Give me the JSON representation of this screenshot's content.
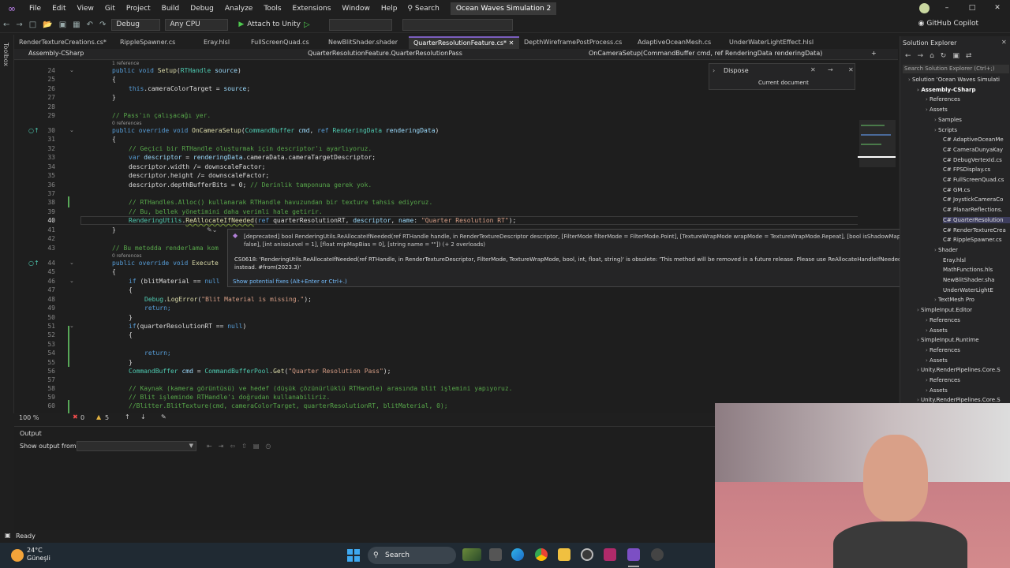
{
  "menu": {
    "items": [
      "File",
      "Edit",
      "View",
      "Git",
      "Project",
      "Build",
      "Debug",
      "Analyze",
      "Tools",
      "Extensions",
      "Window",
      "Help"
    ],
    "search_label": "Search",
    "solution_title": "Ocean Waves Simulation 2"
  },
  "toolbar": {
    "config": "Debug",
    "platform": "Any CPU",
    "attach_label": "Attach to Unity",
    "copilot_label": "GitHub Copilot"
  },
  "left_strip": {
    "label": "Toolbox"
  },
  "tabs": [
    {
      "label": "RenderTextureCreations.cs*",
      "active": false
    },
    {
      "label": "RippleSpawner.cs",
      "active": false
    },
    {
      "label": "Eray.hlsl",
      "active": false
    },
    {
      "label": "FullScreenQuad.cs",
      "active": false
    },
    {
      "label": "NewBlitShader.shader",
      "active": false
    },
    {
      "label": "QuarterResolutionFeature.cs*",
      "active": true
    },
    {
      "label": "DepthWireframePostProcess.cs",
      "active": false
    },
    {
      "label": "AdaptiveOceanMesh.cs",
      "active": false
    },
    {
      "label": "UnderWaterLightEffect.hlsl",
      "active": false
    }
  ],
  "navbar": {
    "project": "Assembly-CSharp",
    "class": "QuarterResolutionFeature.QuarterResolutionPass",
    "member": "OnCameraSetup(CommandBuffer cmd, ref RenderingData renderingData)"
  },
  "code": {
    "refs_1": "1 reference",
    "refs_0": "0 references",
    "lines": [
      {
        "n": "24",
        "text": "public void Setup(RTHandle source)"
      },
      {
        "n": "25",
        "text": "{"
      },
      {
        "n": "26",
        "text": "this.cameraColorTarget = source;"
      },
      {
        "n": "27",
        "text": "}"
      },
      {
        "n": "28",
        "text": ""
      },
      {
        "n": "29",
        "text": "// Pass'ın çalışacağı yer."
      },
      {
        "n": "30",
        "text": "public override void OnCameraSetup(CommandBuffer cmd, ref RenderingData renderingData)"
      },
      {
        "n": "31",
        "text": "{"
      },
      {
        "n": "32",
        "text": "// Geçici bir RTHandle oluşturmak için descriptor'ı ayarlıyoruz."
      },
      {
        "n": "33",
        "text": "var descriptor = renderingData.cameraData.cameraTargetDescriptor;"
      },
      {
        "n": "34",
        "text": "descriptor.width /= downscaleFactor;"
      },
      {
        "n": "35",
        "text": "descriptor.height /= downscaleFactor;"
      },
      {
        "n": "36",
        "text": "descriptor.depthBufferBits = 0; // Derinlik tamponuna gerek yok."
      },
      {
        "n": "37",
        "text": ""
      },
      {
        "n": "38",
        "text": "// RTHandles.Alloc() kullanarak RTHandle havuzundan bir texture tahsis ediyoruz."
      },
      {
        "n": "39",
        "text": "// Bu, bellek yönetimini daha verimli hale getirir."
      },
      {
        "n": "40",
        "text": "RenderingUtils.ReAllocateIfNeeded(ref quarterResolutionRT, descriptor, name: \"Quarter Resolution RT\");"
      },
      {
        "n": "41",
        "text": "}"
      },
      {
        "n": "42",
        "text": ""
      },
      {
        "n": "43",
        "text": "// Bu metodda renderlama kom"
      },
      {
        "n": "44",
        "text": "public override void Execute"
      },
      {
        "n": "45",
        "text": "{"
      },
      {
        "n": "46",
        "text": "if (blitMaterial == null"
      },
      {
        "n": "47",
        "text": "{"
      },
      {
        "n": "48",
        "text": "Debug.LogError(\"Blit Material is missing.\");"
      },
      {
        "n": "49",
        "text": "return;"
      },
      {
        "n": "50",
        "text": "}"
      },
      {
        "n": "51",
        "text": "if(quarterResolutionRT == null)"
      },
      {
        "n": "52",
        "text": "{"
      },
      {
        "n": "53",
        "text": ""
      },
      {
        "n": "54",
        "text": "return;"
      },
      {
        "n": "55",
        "text": "}"
      },
      {
        "n": "56",
        "text": "CommandBuffer cmd = CommandBufferPool.Get(\"Quarter Resolution Pass\");"
      },
      {
        "n": "57",
        "text": ""
      },
      {
        "n": "58",
        "text": "// Kaynak (kamera görüntüsü) ve hedef (düşük çözünürlüklü RTHandle) arasında blit işlemini yapıyoruz."
      },
      {
        "n": "59",
        "text": "// Blit işleminde RTHandle'ı doğrudan kullanabiliriz."
      },
      {
        "n": "60",
        "text": "//Blitter.BlitTexture(cmd, cameraColorTarget, quarterResolutionRT, blitMaterial, 0);"
      }
    ]
  },
  "dispose_panel": {
    "title": "Dispose",
    "scope": "Current document"
  },
  "tooltip": {
    "signature": "[deprecated] bool RenderingUtils.ReAllocateIfNeeded(ref RTHandle handle, in RenderTextureDescriptor descriptor, [FilterMode filterMode = FilterMode.Point], [TextureWrapMode wrapMode = TextureWrapMode.Repeat], [bool isShadowMap = false], [int anisoLevel = 1], [float mipMapBias = 0], [string name = \"\"]) (+ 2 overloads)",
    "warning": "CS0618: 'RenderingUtils.ReAllocateIfNeeded(ref RTHandle, in RenderTextureDescriptor, FilterMode, TextureWrapMode, bool, int, float, string)' is obsolete: 'This method will be removed in a future release. Please use ReAllocateHandleIfNeeded",
    "warning2": "instead. #from(2023.3)'",
    "fix": "Show potential fixes (Alt+Enter or Ctrl+.)"
  },
  "editor_status": {
    "zoom": "100 %",
    "errors": "0",
    "warnings": "5"
  },
  "solution_explorer": {
    "title": "Solution Explorer",
    "search_placeholder": "Search Solution Explorer (Ctrl+;)",
    "nodes": [
      {
        "label": "Solution 'Ocean Waves Simulati",
        "depth": 0,
        "bold": false
      },
      {
        "label": "Assembly-CSharp",
        "depth": 1,
        "bold": true
      },
      {
        "label": "References",
        "depth": 2,
        "bold": false
      },
      {
        "label": "Assets",
        "depth": 2,
        "bold": false
      },
      {
        "label": "Samples",
        "depth": 3,
        "bold": false
      },
      {
        "label": "Scripts",
        "depth": 3,
        "bold": false
      },
      {
        "label": "C# AdaptiveOceanMe",
        "depth": 4,
        "bold": false
      },
      {
        "label": "C# CameraDunyaKay",
        "depth": 4,
        "bold": false
      },
      {
        "label": "C# DebugVertexId.cs",
        "depth": 4,
        "bold": false
      },
      {
        "label": "C# FPSDisplay.cs",
        "depth": 4,
        "bold": false
      },
      {
        "label": "C# FullScreenQuad.cs",
        "depth": 4,
        "bold": false
      },
      {
        "label": "C# GM.cs",
        "depth": 4,
        "bold": false
      },
      {
        "label": "C# JoystickCameraCo",
        "depth": 4,
        "bold": false
      },
      {
        "label": "C# PlanarReflections.",
        "depth": 4,
        "bold": false
      },
      {
        "label": "C# QuarterResolution",
        "depth": 4,
        "bold": false,
        "sel": true
      },
      {
        "label": "C# RenderTextureCrea",
        "depth": 4,
        "bold": false
      },
      {
        "label": "C# RippleSpawner.cs",
        "depth": 4,
        "bold": false
      },
      {
        "label": "Shader",
        "depth": 3,
        "bold": false
      },
      {
        "label": "Eray.hlsl",
        "depth": 4,
        "bold": false
      },
      {
        "label": "MathFunctions.hls",
        "depth": 4,
        "bold": false
      },
      {
        "label": "NewBlitShader.sha",
        "depth": 4,
        "bold": false
      },
      {
        "label": "UnderWaterLightE",
        "depth": 4,
        "bold": false
      },
      {
        "label": "TextMesh Pro",
        "depth": 3,
        "bold": false
      },
      {
        "label": "SimpleInput.Editor",
        "depth": 1,
        "bold": false
      },
      {
        "label": "References",
        "depth": 2,
        "bold": false
      },
      {
        "label": "Assets",
        "depth": 2,
        "bold": false
      },
      {
        "label": "SimpleInput.Runtime",
        "depth": 1,
        "bold": false
      },
      {
        "label": "References",
        "depth": 2,
        "bold": false
      },
      {
        "label": "Assets",
        "depth": 2,
        "bold": false
      },
      {
        "label": "Unity.RenderPipelines.Core.S",
        "depth": 1,
        "bold": false
      },
      {
        "label": "References",
        "depth": 2,
        "bold": false
      },
      {
        "label": "Assets",
        "depth": 2,
        "bold": false
      },
      {
        "label": "Unity.RenderPipelines.Core.S",
        "depth": 1,
        "bold": false
      }
    ]
  },
  "output": {
    "title": "Output",
    "show_from_label": "Show output from:"
  },
  "status": {
    "text": "Ready"
  },
  "taskbar": {
    "temp": "24°C",
    "weather": "Güneşli",
    "search": "Search"
  },
  "colors": {
    "accent": "#7c5fbf",
    "keyword": "#569cd6",
    "type": "#4ec9b0",
    "comment": "#57a64a",
    "string": "#d69d85"
  }
}
